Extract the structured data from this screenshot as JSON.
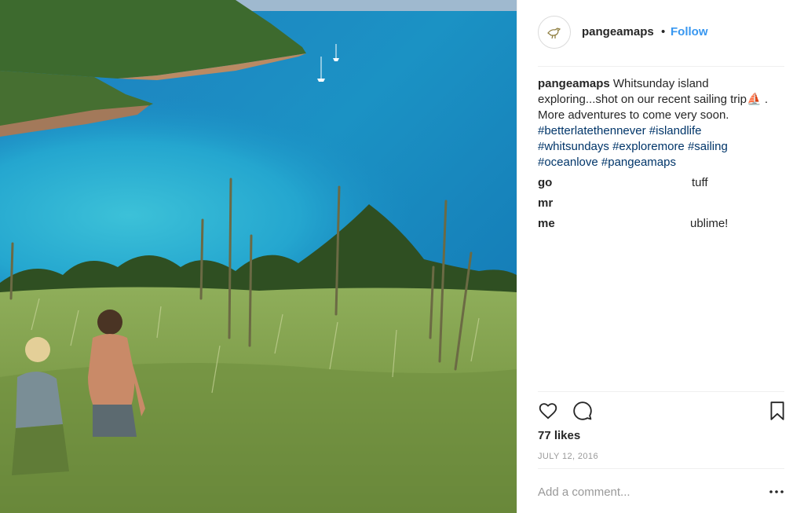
{
  "post": {
    "username": "pangeamaps",
    "separator": "•",
    "follow_label": "Follow",
    "caption_username": "pangeamaps",
    "caption_line1": " Whitsunday island",
    "caption_line2": "exploring...shot on our recent sailing trip⛵ .",
    "caption_line3": "More adventures to come very soon.",
    "hashtags_line1": [
      "#betterlatethennever",
      "#islandlife"
    ],
    "hashtags_line2": [
      "#whitsundays",
      "#exploremore",
      "#sailing"
    ],
    "hashtags_line3": [
      "#oceanlove",
      "#pangeamaps"
    ],
    "comments": [
      {
        "user": "go",
        "text": "tuff"
      },
      {
        "user": "mr",
        "text": ""
      },
      {
        "user": "me",
        "text": "ublime!"
      }
    ],
    "likes": "77 likes",
    "date": "JULY 12, 2016",
    "add_comment_placeholder": "Add a comment..."
  },
  "icons": {
    "avatar": "bird-logo-icon",
    "like": "heart-icon",
    "comment": "comment-bubble-icon",
    "save": "bookmark-icon",
    "more": "more-dots-icon"
  },
  "colors": {
    "link": "#3897f0",
    "hashtag": "#003569",
    "text": "#262626",
    "muted": "#999999"
  }
}
